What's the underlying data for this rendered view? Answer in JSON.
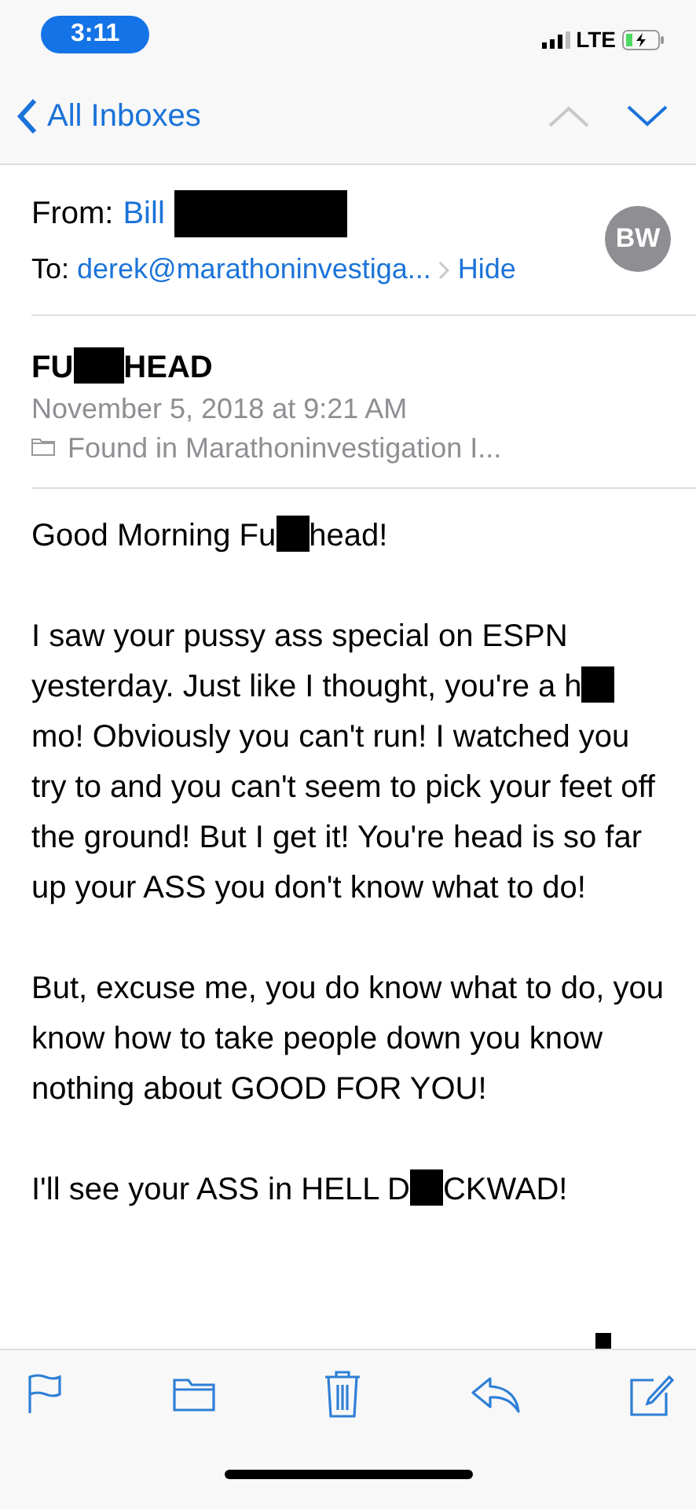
{
  "status_bar": {
    "time": "3:11",
    "network": "LTE"
  },
  "nav": {
    "back_label": "All Inboxes",
    "prev": {
      "disabled": true
    },
    "next": {
      "disabled": false
    }
  },
  "header": {
    "from_label": "From:",
    "from_name": "Bill",
    "from_redacted": true,
    "to_label": "To:",
    "to_address": "derek@marathoninvestiga...",
    "hide_label": "Hide",
    "avatar_initials": "BW"
  },
  "subject": [
    {
      "kind": "text",
      "text": "FU"
    },
    {
      "kind": "redaction"
    },
    {
      "kind": "text",
      "text": "HEAD"
    }
  ],
  "date": "November 5, 2018 at 9:21 AM",
  "folder": "Found in Marathoninvestigation I...",
  "body": [
    [
      {
        "kind": "text",
        "text": "Good Morning Fu"
      },
      {
        "kind": "redaction"
      },
      {
        "kind": "text",
        "text": "head!"
      }
    ],
    [
      {
        "kind": "text",
        "text": "I saw your pussy ass special on ESPN yesterday. Just like I thought, you're a h"
      },
      {
        "kind": "redaction"
      },
      {
        "kind": "text",
        "text": "mo! Obviously you can't run! I watched you try to and you can't seem to pick your feet off the ground! But I get it! You're head is so far up your ASS you don't know what to do!"
      }
    ],
    [
      {
        "kind": "text",
        "text": "But, excuse me, you do know what to do, you know how to take people down you know nothing about GOOD FOR YOU!"
      }
    ],
    [
      {
        "kind": "text",
        "text": "I'll see your ASS in HELL D"
      },
      {
        "kind": "redaction"
      },
      {
        "kind": "text",
        "text": "CKWAD!"
      }
    ]
  ],
  "toolbar": [
    {
      "kind": "flag"
    },
    {
      "kind": "folder"
    },
    {
      "kind": "trash"
    },
    {
      "kind": "reply"
    },
    {
      "kind": "compose"
    }
  ]
}
